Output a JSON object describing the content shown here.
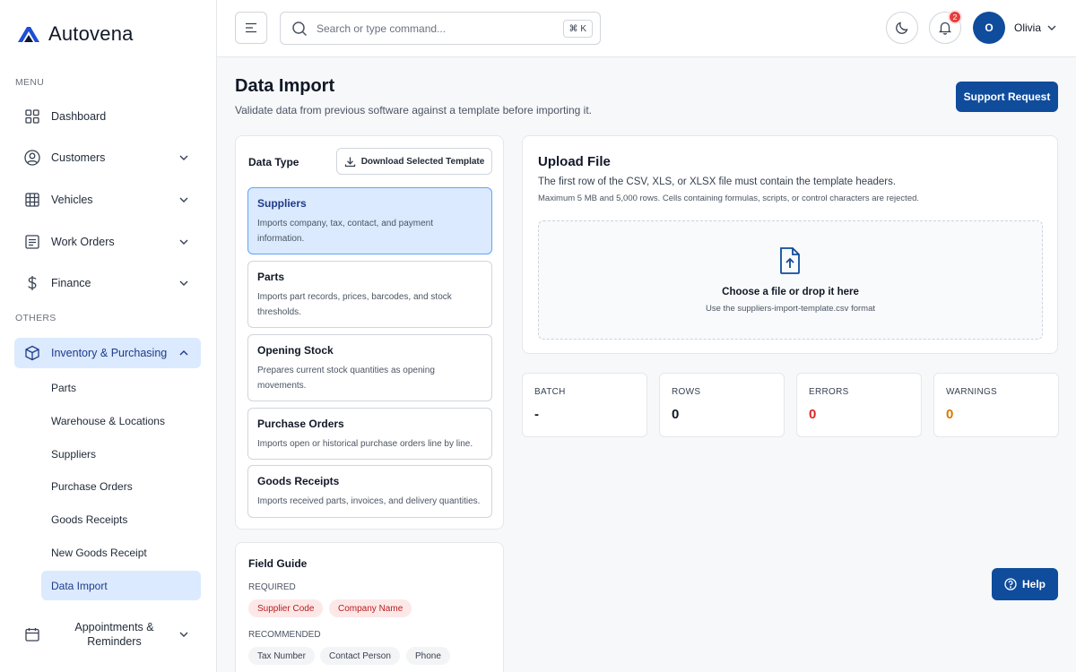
{
  "brand": {
    "name": "Autovena"
  },
  "sidebar": {
    "menu_label": "MENU",
    "others_label": "OTHERS",
    "items": [
      {
        "label": "Dashboard",
        "icon": "grid-icon"
      },
      {
        "label": "Customers",
        "icon": "user-circle-icon"
      },
      {
        "label": "Vehicles",
        "icon": "table-icon"
      },
      {
        "label": "Work Orders",
        "icon": "list-icon"
      },
      {
        "label": "Finance",
        "icon": "dollar-icon"
      },
      {
        "label": "Inventory & Purchasing",
        "icon": "box-icon"
      },
      {
        "label": "Appointments &\nReminders",
        "icon": "calendar-icon"
      }
    ],
    "sub_items": [
      {
        "label": "Parts"
      },
      {
        "label": "Warehouse & Locations"
      },
      {
        "label": "Suppliers"
      },
      {
        "label": "Purchase Orders"
      },
      {
        "label": "Goods Receipts"
      },
      {
        "label": "New Goods Receipt"
      },
      {
        "label": "Data Import"
      }
    ]
  },
  "topbar": {
    "search_placeholder": "Search or type command...",
    "shortcut": "⌘ K",
    "notification_count": "2",
    "avatar_initial": "O",
    "user_name": "Olivia"
  },
  "page": {
    "title": "Data Import",
    "subtitle": "Validate data from previous software against a template before importing it.",
    "support_button": "Support Request"
  },
  "data_type": {
    "title": "Data Type",
    "download_button": "Download Selected Template",
    "options": [
      {
        "title": "Suppliers",
        "desc": "Imports company, tax, contact, and payment information."
      },
      {
        "title": "Parts",
        "desc": "Imports part records, prices, barcodes, and stock thresholds."
      },
      {
        "title": "Opening Stock",
        "desc": "Prepares current stock quantities as opening movements."
      },
      {
        "title": "Purchase Orders",
        "desc": "Imports open or historical purchase orders line by line."
      },
      {
        "title": "Goods Receipts",
        "desc": "Imports received parts, invoices, and delivery quantities."
      }
    ]
  },
  "upload": {
    "title": "Upload File",
    "subtitle": "The first row of the CSV, XLS, or XLSX file must contain the template headers.",
    "limits": "Maximum 5 MB and 5,000 rows. Cells containing formulas, scripts, or control characters are rejected.",
    "drop_title": "Choose a file or drop it here",
    "drop_hint": "Use the suppliers-import-template.csv format"
  },
  "stats": [
    {
      "label": "BATCH",
      "value": "-",
      "color": "#111827"
    },
    {
      "label": "ROWS",
      "value": "0",
      "color": "#111827"
    },
    {
      "label": "ERRORS",
      "value": "0",
      "color": "#dc2626"
    },
    {
      "label": "WARNINGS",
      "value": "0",
      "color": "#d97706"
    }
  ],
  "field_guide": {
    "title": "Field Guide",
    "required_label": "REQUIRED",
    "required": [
      "Supplier Code",
      "Company Name"
    ],
    "recommended_label": "RECOMMENDED",
    "recommended": [
      "Tax Number",
      "Contact Person",
      "Phone"
    ]
  },
  "help_button": "Help",
  "colors": {
    "primary": "#0f4c9c",
    "active_bg": "#dbeafe"
  }
}
